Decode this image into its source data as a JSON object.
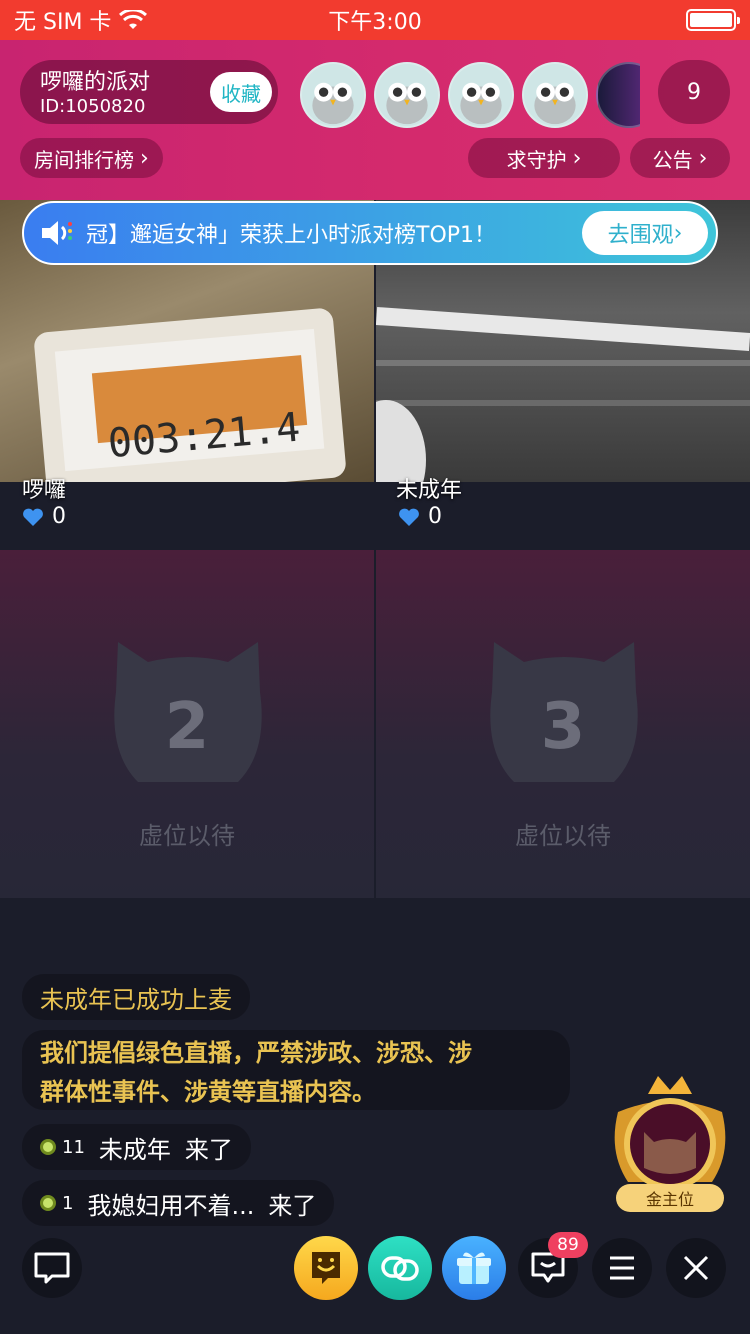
{
  "status_bar": {
    "carrier": "无 SIM 卡",
    "time": "下午3:00"
  },
  "header": {
    "room_name": "啰囉的派对",
    "room_id": "ID:1050820",
    "favorite_label": "收藏",
    "online_count": "9",
    "ranking_label": "房间排行榜",
    "guard_label": "求守护",
    "notice_label": "公告"
  },
  "marquee": {
    "text": "冠】邂逅女神」荣获上小时派对榜TOP1！",
    "button_label": "去围观"
  },
  "seats": [
    {
      "name": "啰囉",
      "hearts": "0"
    },
    {
      "name": "未成年",
      "hearts": "0"
    },
    {
      "number": "2",
      "status": "虚位以待"
    },
    {
      "number": "3",
      "status": "虚位以待"
    }
  ],
  "chat": {
    "system_join": "未成年已成功上麦",
    "notice_line1": "我们提倡绿色直播，严禁涉政、涉恐、涉",
    "notice_line2": "群体性事件、涉黄等直播内容。",
    "messages": [
      {
        "level": "11",
        "user": "未成年",
        "action": "来了"
      },
      {
        "level": "1",
        "user": "我媳妇用不着...",
        "action": "来了"
      }
    ]
  },
  "gold_seat_label": "金主位",
  "bottom_bar": {
    "message_badge": "89"
  },
  "colors": {
    "status_bar": "#f23b2f",
    "header": "#c82470",
    "background": "#1b1d2a",
    "gold_text": "#e9c352"
  }
}
